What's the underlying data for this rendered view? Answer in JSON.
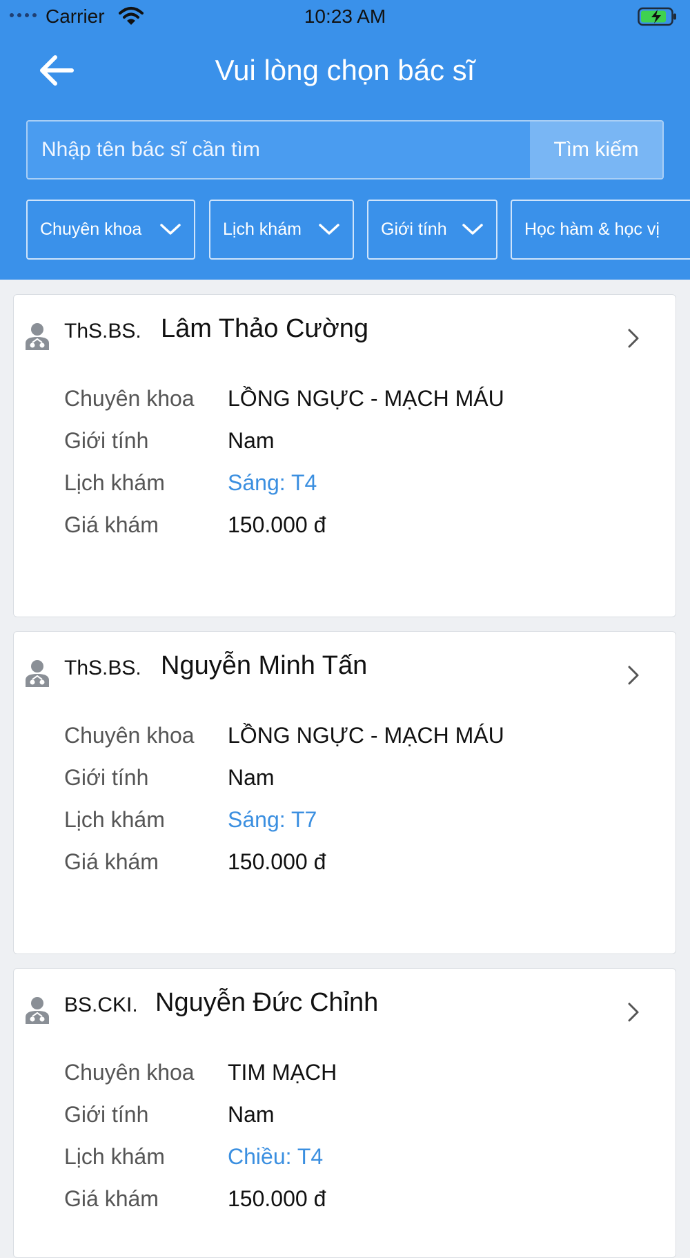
{
  "status_bar": {
    "carrier": "Carrier",
    "time": "10:23 AM",
    "icons": [
      "signal-dots-icon",
      "wifi-icon",
      "battery-charging-icon"
    ]
  },
  "header": {
    "title": "Vui lòng chọn bác sĩ",
    "back_icon": "arrow-left-icon"
  },
  "search": {
    "placeholder": "Nhập tên bác sĩ cần tìm",
    "value": "",
    "button_label": "Tìm kiếm"
  },
  "filters": [
    {
      "label": "Chuyên khoa"
    },
    {
      "label": "Lịch khám"
    },
    {
      "label": "Giới tính"
    },
    {
      "label": "Học hàm & học vị"
    }
  ],
  "labels": {
    "specialty": "Chuyên khoa",
    "gender": "Giới tính",
    "schedule": "Lịch khám",
    "price": "Giá khám"
  },
  "doctors": [
    {
      "title": "ThS.BS.",
      "name": "Lâm Thảo Cường",
      "specialty": "LỒNG NGỰC - MẠCH MÁU",
      "gender": "Nam",
      "schedule": "Sáng: T4",
      "price": "150.000 đ"
    },
    {
      "title": "ThS.BS.",
      "name": "Nguyễn Minh Tấn",
      "specialty": "LỒNG NGỰC - MẠCH MÁU",
      "gender": "Nam",
      "schedule": "Sáng: T7",
      "price": "150.000 đ"
    },
    {
      "title": "BS.CKI.",
      "name": "Nguyễn Đức Chỉnh",
      "specialty": "TIM MẠCH",
      "gender": "Nam",
      "schedule": "Chiều: T4",
      "price": "150.000 đ"
    }
  ],
  "colors": {
    "header_bg": "#3a91ea",
    "search_button_bg": "#79b6f4",
    "link": "#3b8fe0",
    "page_bg": "#eef0f3"
  }
}
